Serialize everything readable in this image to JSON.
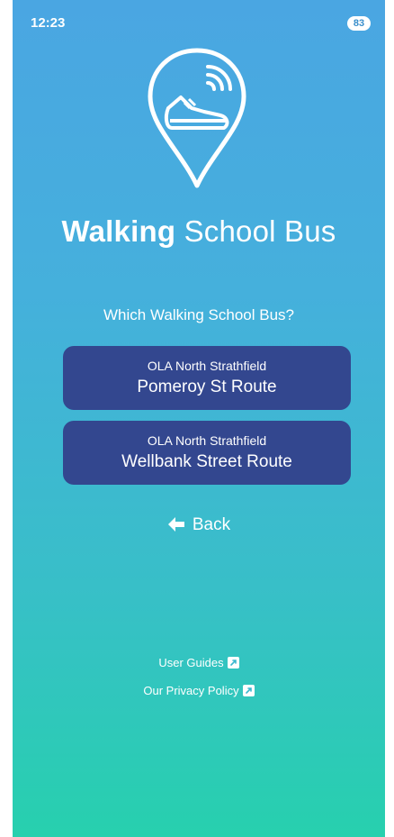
{
  "status_bar": {
    "time": "12:23",
    "battery": "83"
  },
  "app": {
    "title_bold": "Walking",
    "title_rest": "School Bus",
    "logo_icon": "shoe-location-pin-icon"
  },
  "prompt": "Which Walking School Bus?",
  "routes": [
    {
      "school": "OLA North Strathfield",
      "route": "Pomeroy St Route"
    },
    {
      "school": "OLA North Strathfield",
      "route": "Wellbank Street Route"
    }
  ],
  "back_label": "Back",
  "footer": {
    "user_guides": "User Guides",
    "privacy_policy": "Our Privacy Policy"
  },
  "colors": {
    "gradient_top": "#4aa6e2",
    "gradient_bottom": "#27d0ae",
    "button_bg": "#33478f",
    "text": "#ffffff"
  }
}
